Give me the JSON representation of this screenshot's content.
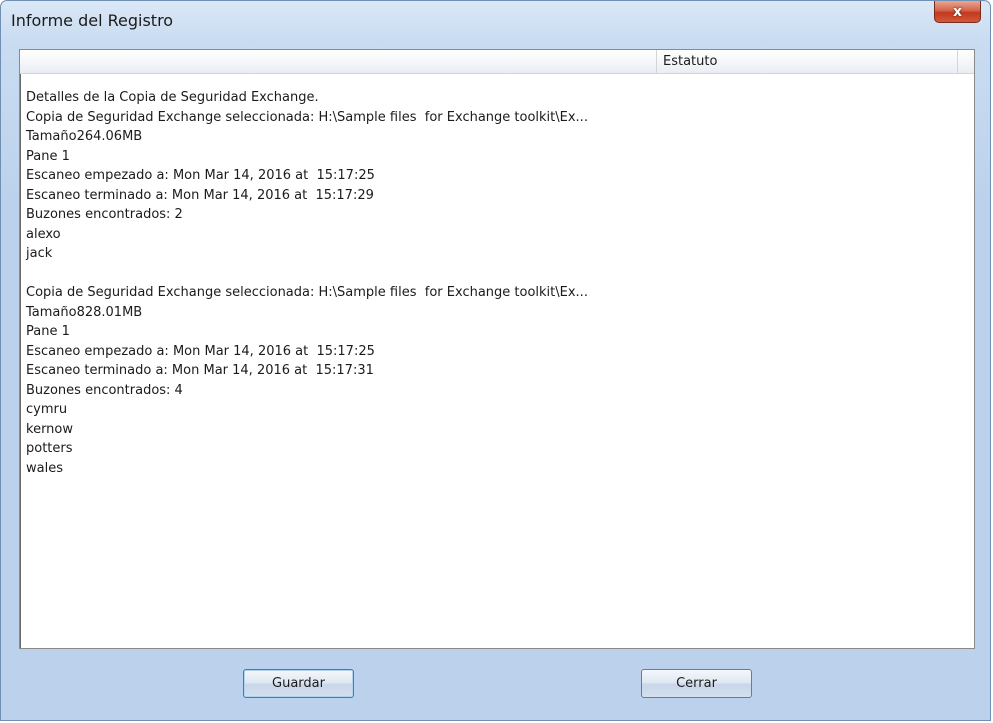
{
  "window": {
    "title": "Informe del Registro",
    "close_label": "x"
  },
  "table": {
    "columns": [
      "",
      "Estatuto",
      ""
    ]
  },
  "log_lines": [
    "Detalles de la Copia de Seguridad Exchange.",
    "Copia de Seguridad Exchange seleccionada: H:\\Sample files  for Exchange toolkit\\Ex...",
    "Tamaño264.06MB",
    "Pane 1",
    "Escaneo empezado a: Mon Mar 14, 2016 at  15:17:25",
    "Escaneo terminado a: Mon Mar 14, 2016 at  15:17:29",
    "Buzones encontrados: 2",
    "alexo",
    "jack",
    "",
    "Copia de Seguridad Exchange seleccionada: H:\\Sample files  for Exchange toolkit\\Ex...",
    "Tamaño828.01MB",
    "Pane 1",
    "Escaneo empezado a: Mon Mar 14, 2016 at  15:17:25",
    "Escaneo terminado a: Mon Mar 14, 2016 at  15:17:31",
    "Buzones encontrados: 4",
    "cymru",
    "kernow",
    "potters",
    "wales"
  ],
  "buttons": {
    "save_label": "Guardar",
    "close_label": "Cerrar"
  }
}
